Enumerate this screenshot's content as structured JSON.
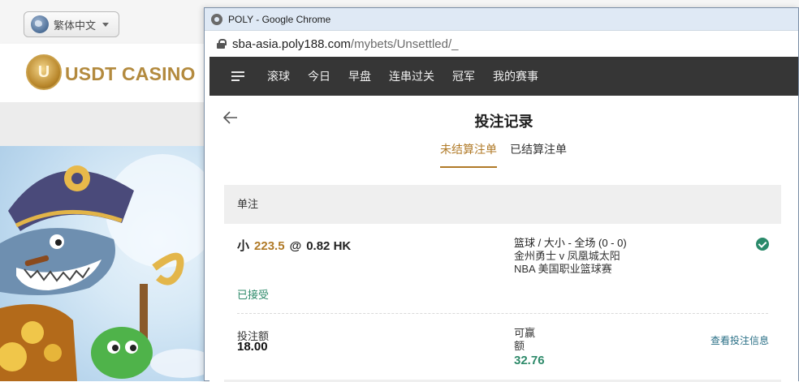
{
  "background_site": {
    "language_label": "繁体中文",
    "logo_emblem": "U",
    "logo_text": "USDT CASINO"
  },
  "window": {
    "title": "POLY - Google Chrome",
    "url_host": "sba-asia.poly188.com",
    "url_path": "/mybets/Unsettled/_"
  },
  "nav": {
    "items": [
      "滚球",
      "今日",
      "早盘",
      "连串过关",
      "冠军",
      "我的赛事"
    ]
  },
  "page": {
    "title": "投注记录",
    "tabs": [
      {
        "label": "未结算注单",
        "active": true
      },
      {
        "label": "已结算注单",
        "active": false
      }
    ],
    "section_label": "单注"
  },
  "bet": {
    "selection": "小",
    "line": "223.5",
    "at": "@",
    "odds": "0.82 HK",
    "market": "篮球 / 大小 - 全场 (0 - 0)",
    "match": "金州勇士 v 凤凰城太阳",
    "league": "NBA 美国职业篮球赛",
    "status": "已接受",
    "stake_label": "投注额",
    "stake_value": "18.00",
    "win_label": "可赢额",
    "win_value": "32.76",
    "details_link": "查看投注信息"
  },
  "colors": {
    "accent": "#b07a27",
    "success": "#2e8a6a",
    "nav_bg": "#363636"
  }
}
